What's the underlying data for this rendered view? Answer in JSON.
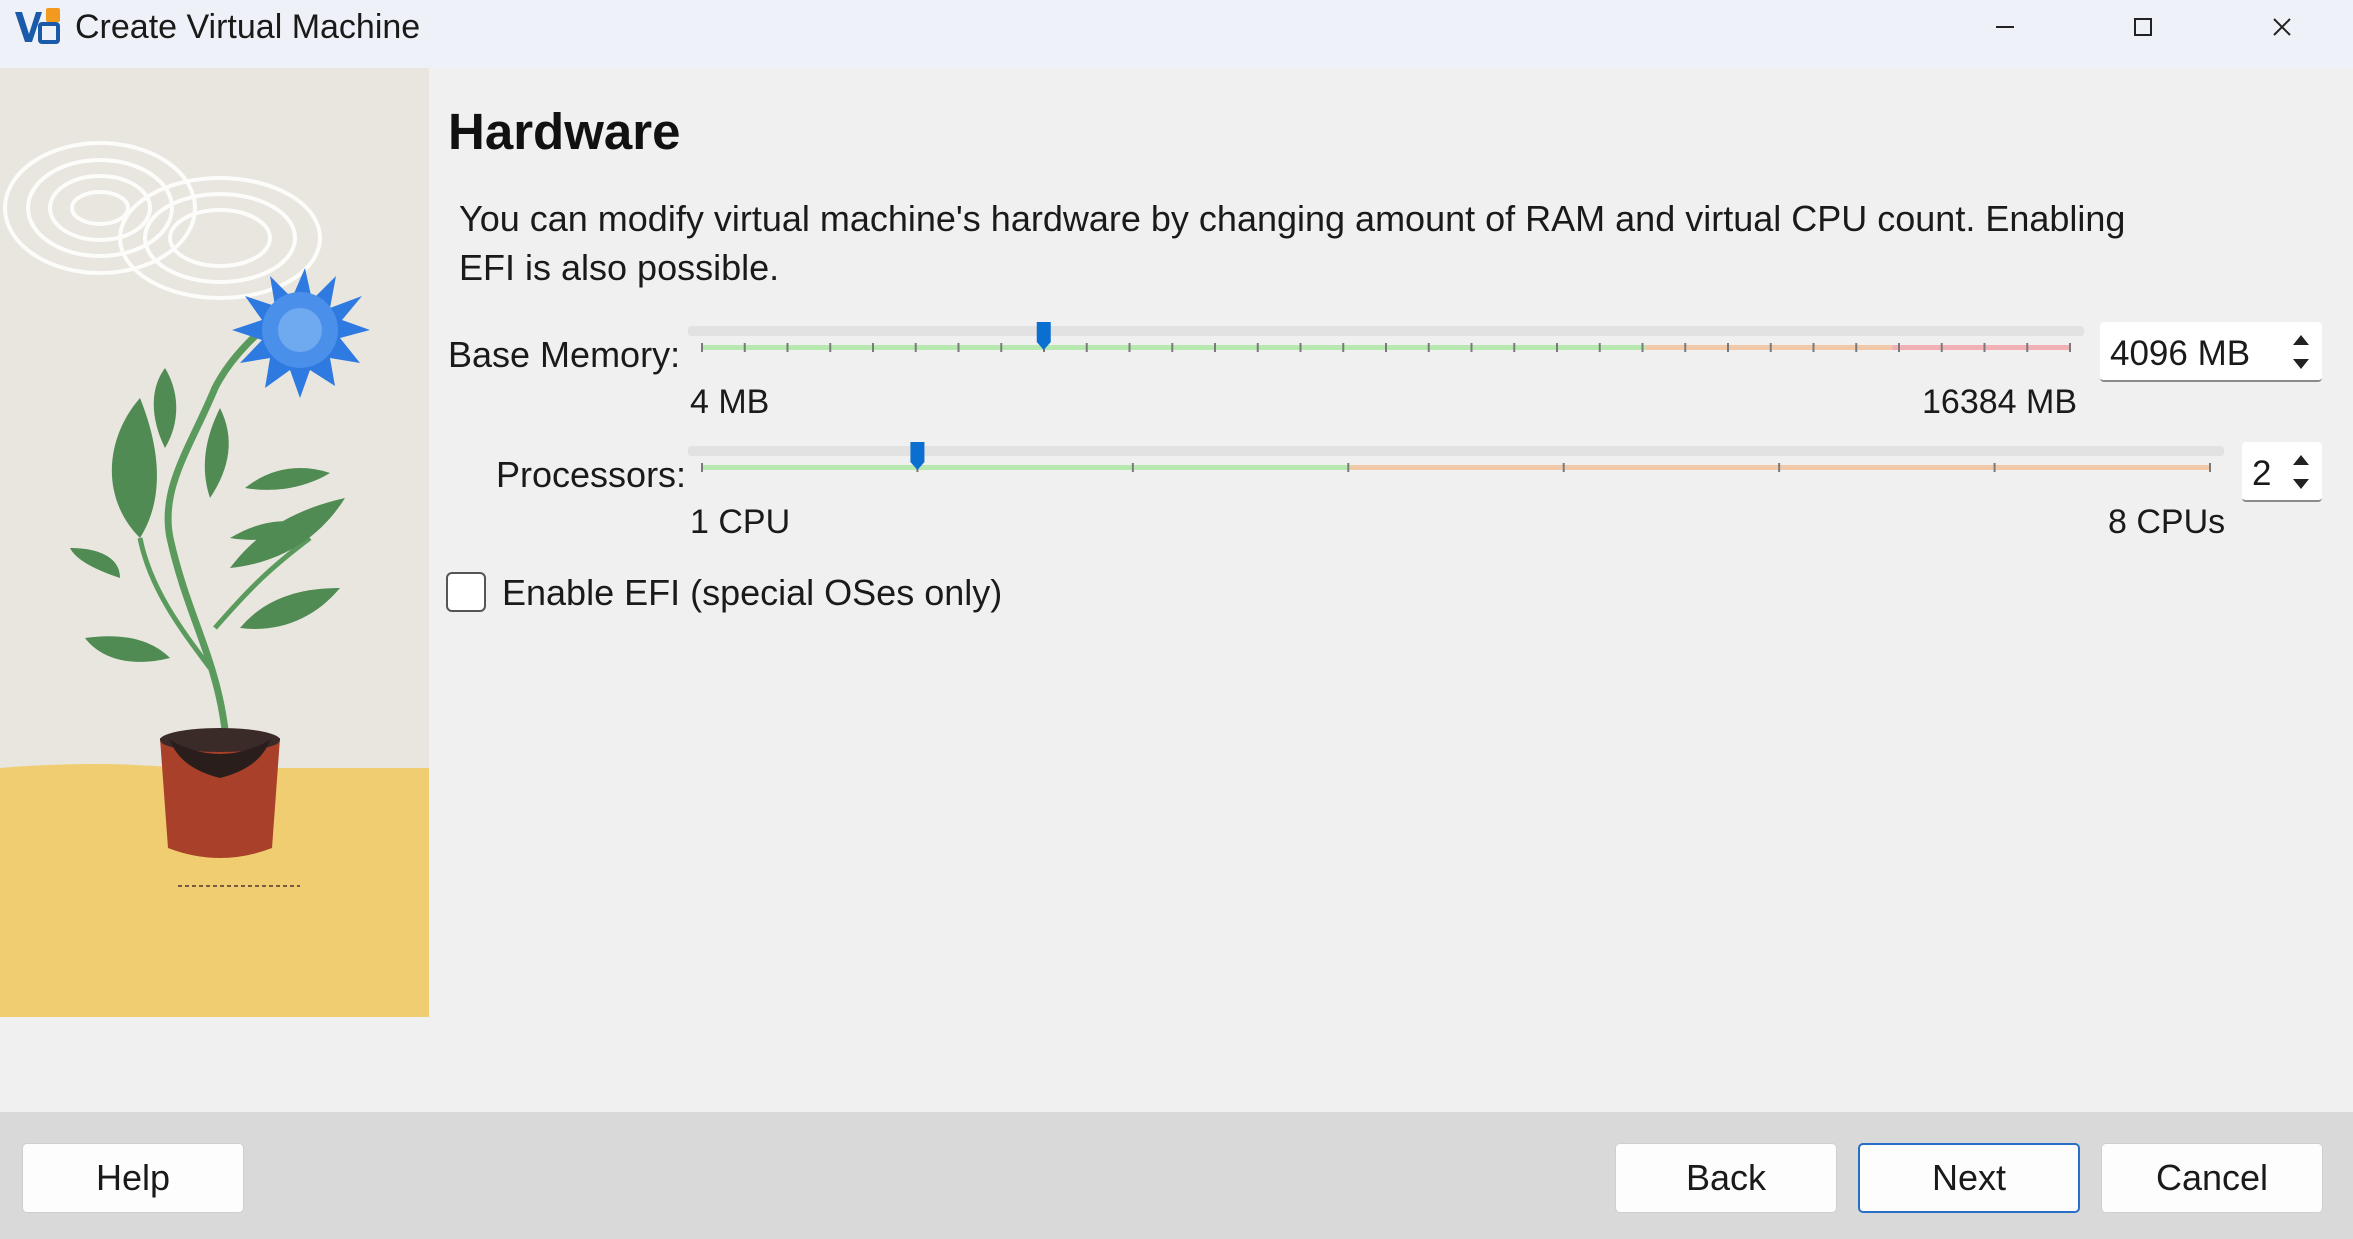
{
  "window": {
    "title": "Create Virtual Machine",
    "app_icon": "virtualbox-icon",
    "controls": [
      "minimize-icon",
      "maximize-icon",
      "close-icon"
    ]
  },
  "page": {
    "heading": "Hardware",
    "description": "You can modify virtual machine's hardware by changing amount of RAM and virtual CPU count. Enabling EFI is also possible."
  },
  "memory": {
    "label": "Base Memory:",
    "min_label": "4 MB",
    "max_label": "16384 MB",
    "min_value": 4,
    "max_value": 16384,
    "value": 4096,
    "spin_text": "4096 MB"
  },
  "processors": {
    "label": "Processors:",
    "min_label": "1 CPU",
    "max_label": "8 CPUs",
    "min_value": 1,
    "max_value": 8,
    "value": 2,
    "spin_text": "2"
  },
  "efi": {
    "label": "Enable EFI (special OSes only)",
    "checked": false
  },
  "footer": {
    "help": "Help",
    "back": "Back",
    "next": "Next",
    "cancel": "Cancel"
  },
  "colors": {
    "slider_thumb": "#0a6fd1",
    "zone_green": "#b6e8b0",
    "zone_orange": "#f2c9a8",
    "zone_red": "#f0b0b4",
    "accent_border": "#2a6fc7",
    "illustration_sand": "#f0cd70",
    "illustration_flower": "#2f7ae0"
  }
}
